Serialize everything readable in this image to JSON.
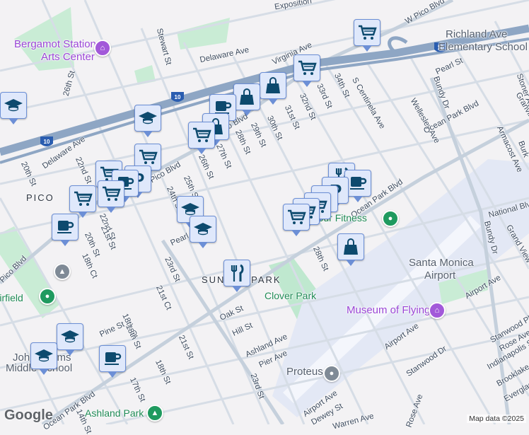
{
  "labels": [
    "Exposition",
    "W Pico Blvd",
    "Richland Ave",
    "Elementary School",
    "Bergamot Station",
    "Arts Center",
    "Stewart St",
    "Delaware Ave",
    "Virginia Ave",
    "26th St",
    "34th St",
    "33rd St",
    "32nd St",
    "31st St",
    "30th St",
    "29th St",
    "28th St",
    "27th St",
    "26th St",
    "25th St",
    "24th St",
    "22nd St",
    "20th St",
    "Delaware Ave",
    "Pico Blvd",
    "Pico Blvd",
    "PICO",
    "22nd St",
    "21st St",
    "20th St",
    "18th Ct",
    "S Centinela Ave",
    "Wellesley Ave",
    "Bundy Dr",
    "Pearl St",
    "Ocean Park Blvd",
    "Ocean Park Blvd",
    "Armacost Ave",
    "Stoner Ave",
    "Granville Ave",
    "Burk",
    "National Blvd",
    "Bundy Dr",
    "Grand View Blvd",
    "24 Hour Fitness",
    "Santa Monica",
    "Airport",
    "Museum of Flying",
    "Airport Ave",
    "Airport Ave",
    "Stanwood Pl",
    "Rose Ave",
    "Indianapolis St",
    "Brooklake",
    "Everglades",
    "Stanwood Dr",
    "Rose Ave",
    "Airport Ave",
    "Dewey St",
    "Warren Ave",
    "28th St",
    "Clover Park",
    "Proteus",
    "SUNSET PARK",
    "Oak St",
    "Hill St",
    "Ashland Ave",
    "Pier Ave",
    "23rd St",
    "23rd St",
    "21st Ct",
    "18th Ct",
    "18th St",
    "Pine St",
    "18th St",
    "21st St",
    "17th St",
    "14th St",
    "Ocean Park Blvd",
    "Ashland Park",
    "Pico Blvd",
    "Airfield",
    "John Adams",
    "Middle School",
    "Pearl St",
    "Stewart St"
  ],
  "markers": [
    "cart",
    "cart",
    "bag",
    "bag",
    "coffee",
    "bag",
    "cart",
    "grad",
    "cart",
    "cart",
    "parking",
    "coffee",
    "cart",
    "cart",
    "coffee",
    "grad",
    "grad",
    "grad",
    "food",
    "coffee",
    "grad",
    "grad",
    "bag",
    "food",
    "coffee",
    "parking",
    "parking",
    "cart",
    "cart",
    "cart"
  ],
  "highway_shield": "10",
  "footer": {
    "logo": "Google",
    "attribution": "Map data ©2025"
  },
  "colors": {
    "marker_bg": "#dfe8fb",
    "marker_icon": "#0d4a6e",
    "freeway": "#8ea6c4",
    "park": "#bfe8cf",
    "airport": "#e3e8f5"
  }
}
